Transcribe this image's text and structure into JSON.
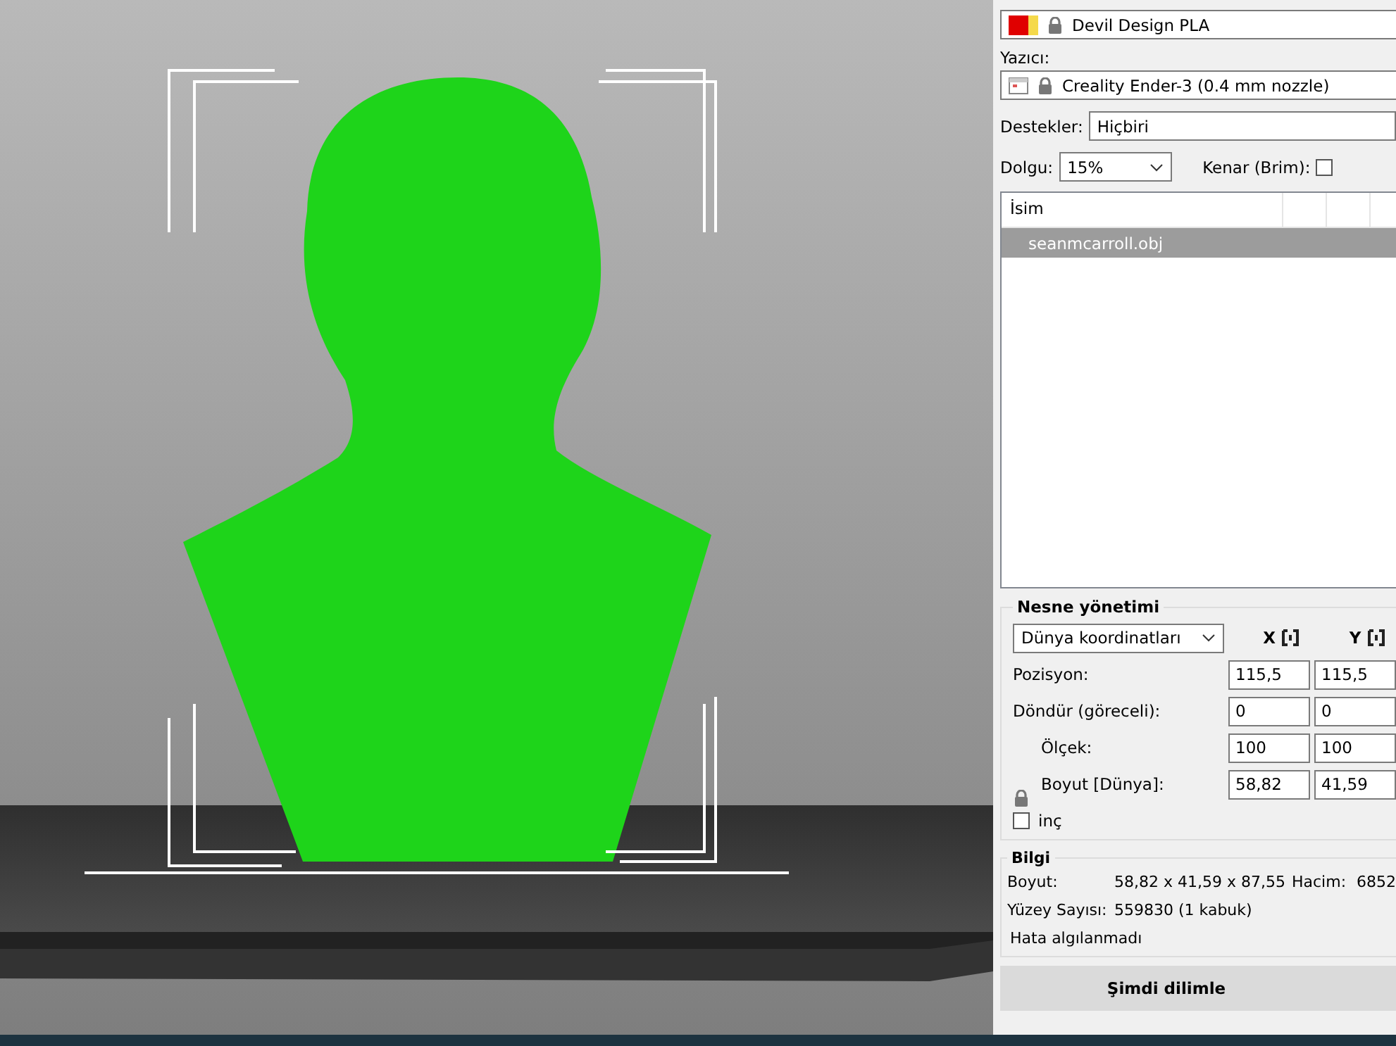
{
  "filament": {
    "name": "Devil Design PLA"
  },
  "printer": {
    "label": "Yazıcı:",
    "name": "Creality Ender-3 (0.4 mm nozzle)"
  },
  "supports": {
    "label": "Destekler:",
    "value": "Hiçbiri"
  },
  "infill": {
    "label": "Dolgu:",
    "value": "15%"
  },
  "brim": {
    "label": "Kenar (Brim):",
    "checked": false
  },
  "object_list": {
    "column": "İsim",
    "rows": [
      {
        "name": "seanmcarroll.obj",
        "selected": true
      }
    ]
  },
  "object_manipulation": {
    "title": "Nesne yönetimi",
    "coordinate_system": "Dünya koordinatları",
    "axes": [
      "X",
      "Y"
    ],
    "rows": [
      {
        "label": "Pozisyon:",
        "values": [
          "115,5",
          "115,5"
        ]
      },
      {
        "label": "Döndür (göreceli):",
        "values": [
          "0",
          "0"
        ]
      },
      {
        "label": "Ölçek:",
        "values": [
          "100",
          "100"
        ]
      },
      {
        "label": "Boyut [Dünya]:",
        "values": [
          "58,82",
          "41,59"
        ]
      }
    ],
    "inches": {
      "label": "inç",
      "checked": false
    }
  },
  "info": {
    "title": "Bilgi",
    "size_label": "Boyut:",
    "size": "58,82 x 41,59 x 87,55",
    "volume_label": "Hacim:",
    "volume": "6852",
    "faces_label": "Yüzey Sayısı:",
    "faces": "559830 (1 kabuk)",
    "status": "Hata algılanmadı"
  },
  "slice_button": "Şimdi dilimle"
}
